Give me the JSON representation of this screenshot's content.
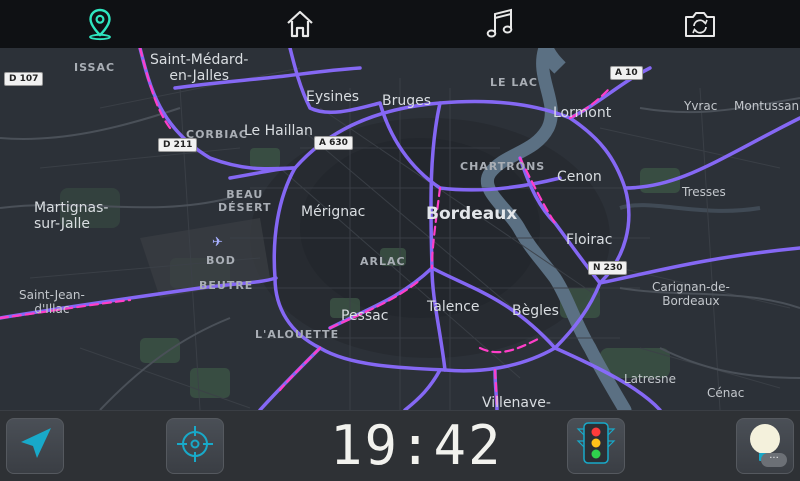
{
  "colors": {
    "accent": "#2fe6c0",
    "route": "#8a6bff",
    "traffic": "#ff3ec8",
    "water": "#5b7083",
    "park": "#3b5244",
    "bar": "#0f1114"
  },
  "top_nav": [
    {
      "id": "navigation",
      "icon": "map-pin-icon",
      "active": true
    },
    {
      "id": "home",
      "icon": "home-icon",
      "active": false
    },
    {
      "id": "music",
      "icon": "music-note-icon",
      "active": false
    },
    {
      "id": "camera",
      "icon": "camera-rotate-icon",
      "active": false
    }
  ],
  "map": {
    "city": "Bordeaux",
    "places": [
      {
        "key": "issac",
        "text": "ISSAC"
      },
      {
        "key": "st_medard",
        "text": "Saint-Médard-\nen-Jalles"
      },
      {
        "key": "eysines",
        "text": "Eysines"
      },
      {
        "key": "bruges",
        "text": "Bruges"
      },
      {
        "key": "le_lac",
        "text": "LE LAC"
      },
      {
        "key": "lormont",
        "text": "Lormont"
      },
      {
        "key": "yvrac",
        "text": "Yvrac"
      },
      {
        "key": "montussan",
        "text": "Montussan"
      },
      {
        "key": "corbiac",
        "text": "CORBIAC"
      },
      {
        "key": "le_haillan",
        "text": "Le Haillan"
      },
      {
        "key": "chartrons",
        "text": "CHARTRONS"
      },
      {
        "key": "cenon",
        "text": "Cenon"
      },
      {
        "key": "tresses",
        "text": "Tresses"
      },
      {
        "key": "beau_desert",
        "text": "BEAU\nDÉSERT"
      },
      {
        "key": "merignac",
        "text": "Mérignac"
      },
      {
        "key": "martignas",
        "text": "Martignas-\nsur-Jalle"
      },
      {
        "key": "floirac",
        "text": "Floirac"
      },
      {
        "key": "bod",
        "text": "BOD"
      },
      {
        "key": "arlac",
        "text": "ARLAC"
      },
      {
        "key": "carignan",
        "text": "Carignan-de-\nBordeaux"
      },
      {
        "key": "beutre",
        "text": "BEUTRE"
      },
      {
        "key": "st_jean_illac",
        "text": "Saint-Jean-\nd'Illac"
      },
      {
        "key": "pessac",
        "text": "Pessac"
      },
      {
        "key": "talence",
        "text": "Talence"
      },
      {
        "key": "begles",
        "text": "Bègles"
      },
      {
        "key": "alouette",
        "text": "L'ALOUETTE"
      },
      {
        "key": "latresne",
        "text": "Latresne"
      },
      {
        "key": "cenac",
        "text": "Cénac"
      },
      {
        "key": "villenave",
        "text": "Villenave-"
      }
    ],
    "roads": [
      {
        "key": "d107",
        "text": "D 107"
      },
      {
        "key": "d211",
        "text": "D 211"
      },
      {
        "key": "a630",
        "text": "A 630"
      },
      {
        "key": "a10",
        "text": "A 10"
      },
      {
        "key": "n230",
        "text": "N 230"
      }
    ]
  },
  "bottom_bar": {
    "clock": "19:42",
    "buttons": [
      {
        "id": "navigate",
        "icon": "navigation-arrow-icon"
      },
      {
        "id": "locate",
        "icon": "crosshair-icon"
      },
      {
        "id": "traffic",
        "icon": "traffic-light-icon"
      },
      {
        "id": "lights",
        "icon": "light-bulb-icon"
      }
    ],
    "more": "···"
  }
}
